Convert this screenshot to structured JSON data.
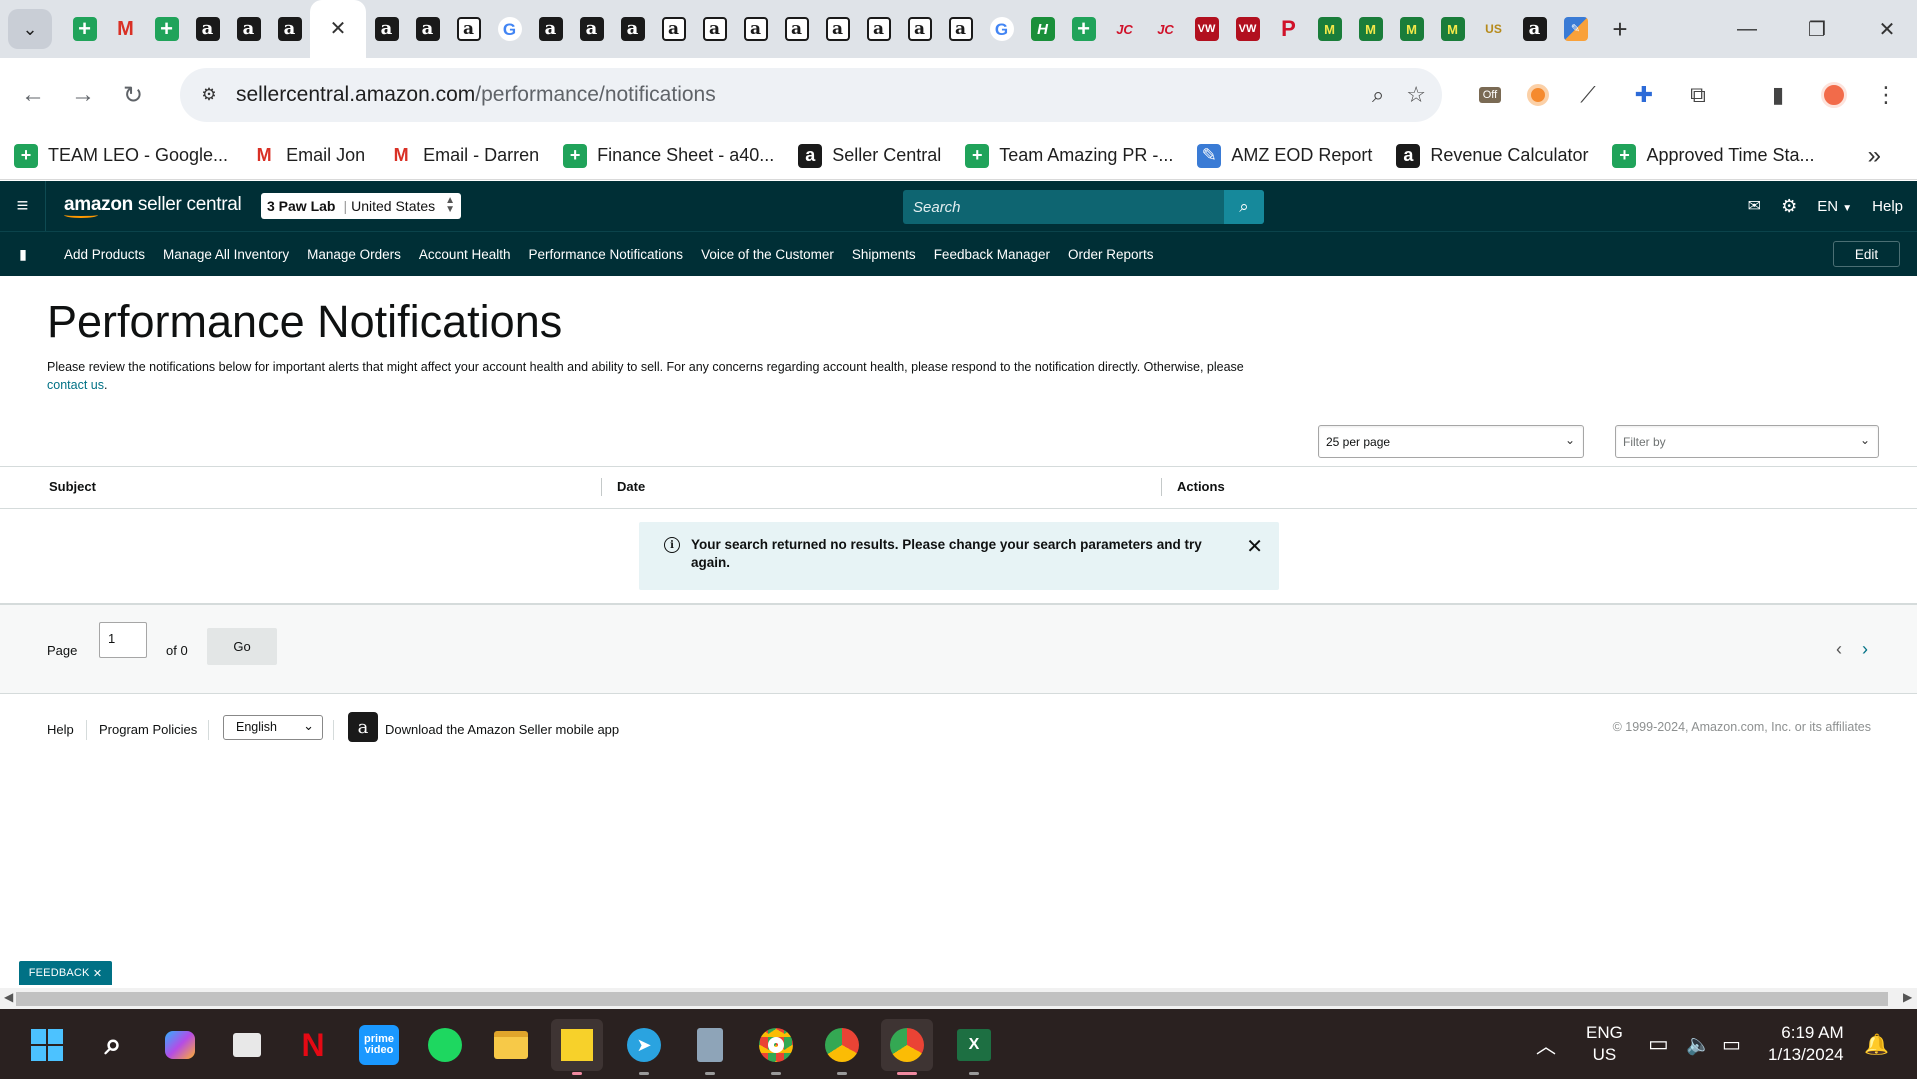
{
  "browser": {
    "tabs_favicons": [
      {
        "icon": "sheets-icon",
        "glyph": "+",
        "cls": "f-sheet"
      },
      {
        "icon": "gmail-icon",
        "glyph": "M",
        "cls": "f-gmail"
      },
      {
        "icon": "sheets-icon",
        "glyph": "+",
        "cls": "f-sheet"
      },
      {
        "icon": "amazon-icon",
        "glyph": "a",
        "cls": "f-amz"
      },
      {
        "icon": "amazon-icon",
        "glyph": "a",
        "cls": "f-amz"
      },
      {
        "icon": "amazon-icon",
        "glyph": "a",
        "cls": "f-amz"
      },
      {
        "icon": "close-tab-icon",
        "glyph": "✕",
        "cls": "active"
      },
      {
        "icon": "amazon-icon",
        "glyph": "a",
        "cls": "f-amz"
      },
      {
        "icon": "amazon-icon",
        "glyph": "a",
        "cls": "f-amz"
      },
      {
        "icon": "amazon-icon",
        "glyph": "a",
        "cls": "f-amzw"
      },
      {
        "icon": "google-icon",
        "glyph": "G",
        "cls": "f-g"
      },
      {
        "icon": "amazon-icon",
        "glyph": "a",
        "cls": "f-amz"
      },
      {
        "icon": "amazon-icon",
        "glyph": "a",
        "cls": "f-amz"
      },
      {
        "icon": "amazon-icon",
        "glyph": "a",
        "cls": "f-amz"
      },
      {
        "icon": "amazon-icon",
        "glyph": "a",
        "cls": "f-amzw"
      },
      {
        "icon": "amazon-icon",
        "glyph": "a",
        "cls": "f-amzw"
      },
      {
        "icon": "amazon-icon",
        "glyph": "a",
        "cls": "f-amzw"
      },
      {
        "icon": "amazon-icon",
        "glyph": "a",
        "cls": "f-amzw"
      },
      {
        "icon": "amazon-icon",
        "glyph": "a",
        "cls": "f-amzw"
      },
      {
        "icon": "amazon-icon",
        "glyph": "a",
        "cls": "f-amzw"
      },
      {
        "icon": "amazon-icon",
        "glyph": "a",
        "cls": "f-amzw"
      },
      {
        "icon": "amazon-icon",
        "glyph": "a",
        "cls": "f-amzw"
      },
      {
        "icon": "google-icon",
        "glyph": "G",
        "cls": "f-g"
      },
      {
        "icon": "h-logo-icon",
        "glyph": "H",
        "cls": "f-h"
      },
      {
        "icon": "sheets-icon",
        "glyph": "+",
        "cls": "f-sheet"
      },
      {
        "icon": "jc-logo-icon",
        "glyph": "JC",
        "cls": "f-jc"
      },
      {
        "icon": "jc-logo-icon",
        "glyph": "JC",
        "cls": "f-jc"
      },
      {
        "icon": "vw-logo-icon",
        "glyph": "VW",
        "cls": "f-vw"
      },
      {
        "icon": "vw-logo-icon",
        "glyph": "VW",
        "cls": "f-vw"
      },
      {
        "icon": "pinterest-icon",
        "glyph": "P",
        "cls": "f-p"
      },
      {
        "icon": "m-logo-icon",
        "glyph": "M",
        "cls": "f-m"
      },
      {
        "icon": "m-logo-icon",
        "glyph": "M",
        "cls": "f-m"
      },
      {
        "icon": "m-logo-icon",
        "glyph": "M",
        "cls": "f-m"
      },
      {
        "icon": "m-logo-icon",
        "glyph": "M",
        "cls": "f-m"
      },
      {
        "icon": "us-foods-icon",
        "glyph": "US",
        "cls": "f-us"
      },
      {
        "icon": "amazon-icon",
        "glyph": "a",
        "cls": "f-amz"
      },
      {
        "icon": "eod-icon",
        "glyph": "✎",
        "cls": "f-eod"
      }
    ],
    "url_host": "sellercentral.amazon.com",
    "url_path": "/performance/notifications",
    "bookmarks": [
      {
        "label": "TEAM LEO - Google...",
        "icon": "sheets-icon",
        "glyph": "+",
        "bg": "#20a35a",
        "fg": "#ffffff"
      },
      {
        "label": "Email Jon",
        "icon": "gmail-icon",
        "glyph": "M",
        "bg": "transparent",
        "fg": "#d93025"
      },
      {
        "label": "Email - Darren",
        "icon": "gmail-icon",
        "glyph": "M",
        "bg": "transparent",
        "fg": "#d93025"
      },
      {
        "label": "Finance Sheet - a40...",
        "icon": "sheets-icon",
        "glyph": "+",
        "bg": "#20a35a",
        "fg": "#ffffff"
      },
      {
        "label": "Seller Central",
        "icon": "amazon-icon",
        "glyph": "a",
        "bg": "#1a1a1a",
        "fg": "#ffffff"
      },
      {
        "label": "Team Amazing PR -...",
        "icon": "sheets-icon",
        "glyph": "+",
        "bg": "#20a35a",
        "fg": "#ffffff"
      },
      {
        "label": "AMZ EOD Report",
        "icon": "eod-icon",
        "glyph": "✎",
        "bg": "#3a7bd5",
        "fg": "#ffffff"
      },
      {
        "label": "Revenue Calculator",
        "icon": "amazon-icon",
        "glyph": "a",
        "bg": "#1a1a1a",
        "fg": "#ffffff"
      },
      {
        "label": "Approved Time Sta...",
        "icon": "sheets-icon",
        "glyph": "+",
        "bg": "#20a35a",
        "fg": "#ffffff"
      }
    ]
  },
  "header": {
    "logo_bold": "amazon",
    "logo_rest": " seller central",
    "account_store": "3 Paw Lab",
    "account_region": "United States",
    "search_placeholder": "Search",
    "lang": "EN",
    "help": "Help"
  },
  "nav": {
    "links": [
      "Add Products",
      "Manage All Inventory",
      "Manage Orders",
      "Account Health",
      "Performance Notifications",
      "Voice of the Customer",
      "Shipments",
      "Feedback Manager",
      "Order Reports"
    ],
    "edit_label": "Edit"
  },
  "main": {
    "title": "Performance Notifications",
    "description": "Please review the notifications below for important alerts that might affect your account health and ability to sell. For any concerns regarding account health, please respond to the notification directly. Otherwise, please",
    "contact_link": "contact us",
    "per_page": "25 per page",
    "filter_placeholder": "Filter by",
    "columns": [
      "Subject",
      "Date",
      "Actions"
    ],
    "alert_text": "Your search returned no results. Please change your search parameters and try again.",
    "pager": {
      "page_label": "Page",
      "page_value": "1",
      "of_label": "of 0",
      "go_label": "Go"
    }
  },
  "footer": {
    "help": "Help",
    "program_policies": "Program Policies",
    "language": "English",
    "app_link": "Download the Amazon Seller mobile app",
    "copyright": "© 1999-2024, Amazon.com, Inc. or its affiliates"
  },
  "feedback_label": "FEEDBACK",
  "taskbar": {
    "lang_top": "ENG",
    "lang_bottom": "US",
    "time": "6:19 AM",
    "date": "1/13/2024"
  }
}
